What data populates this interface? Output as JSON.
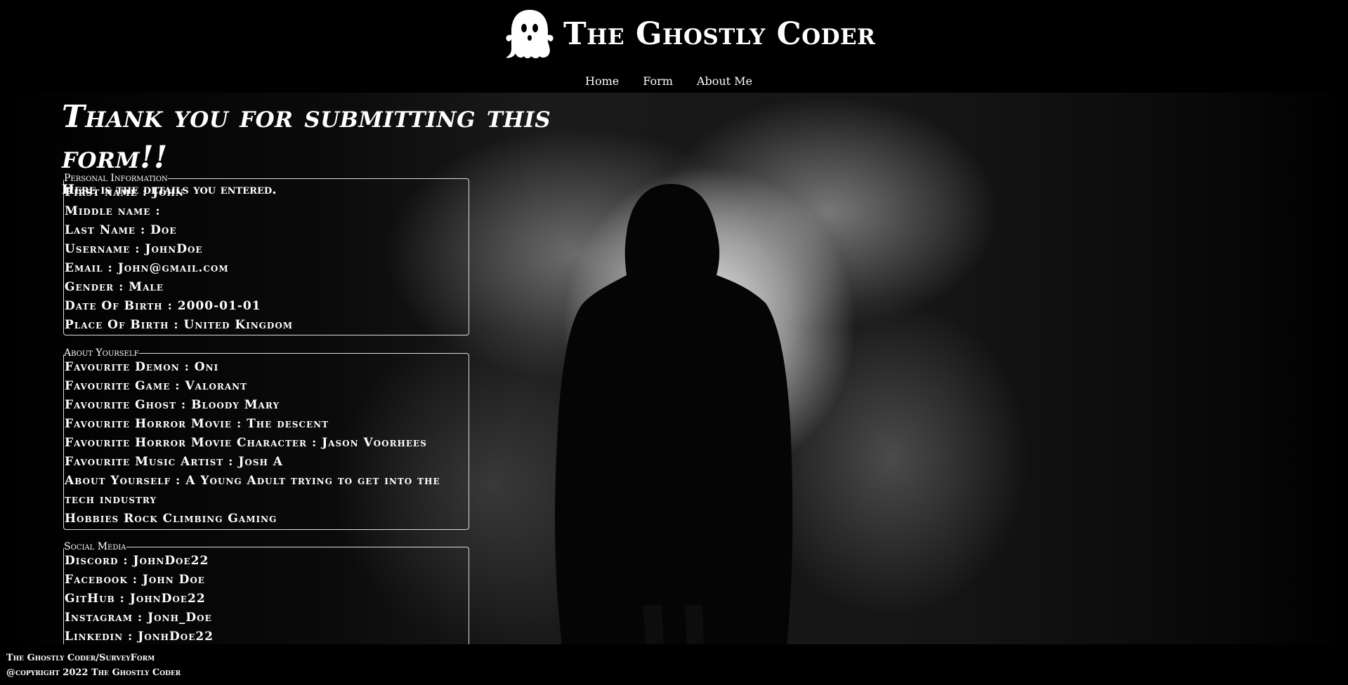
{
  "header": {
    "brand_title": "The Ghostly Coder",
    "logo_icon": "ghost-icon"
  },
  "nav": {
    "items": [
      "Home",
      "Form",
      "About Me"
    ]
  },
  "main": {
    "title": "Thank you for submitting this form!!",
    "subtitle": "Here is the details you entered."
  },
  "personal": {
    "legend": "Personal Information",
    "rows": [
      "First name : John",
      "Middle name :",
      "Last Name : Doe",
      "Username : JohnDoe",
      "Email : John@gmail.com",
      "Gender : Male",
      "Date Of Birth : 2000-01-01",
      "Place Of Birth : United Kingdom"
    ]
  },
  "about": {
    "legend": "About Yourself",
    "rows": [
      "Favourite Demon : Oni",
      "Favourite Game : Valorant",
      "Favourite Ghost : Bloody Mary",
      "Favourite Horror Movie : The descent",
      "Favourite Horror Movie Character : Jason Voorhees",
      "Favourite Music Artist : Josh A",
      "About Yourself : A Young Adult trying to get into the tech industry",
      "Hobbies Rock Climbing Gaming"
    ]
  },
  "social": {
    "legend": "Social Media",
    "rows": [
      "Discord : JohnDoe22",
      "Facebook : John Doe",
      "GitHub : JohnDoe22",
      "Instagram : Jonh_Doe",
      "Linkedin : JonhDoe22"
    ]
  },
  "footer": {
    "line1": "The Ghostly Coder/SurveyForm",
    "line2": "@copyright 2022 The Ghostly Coder"
  }
}
